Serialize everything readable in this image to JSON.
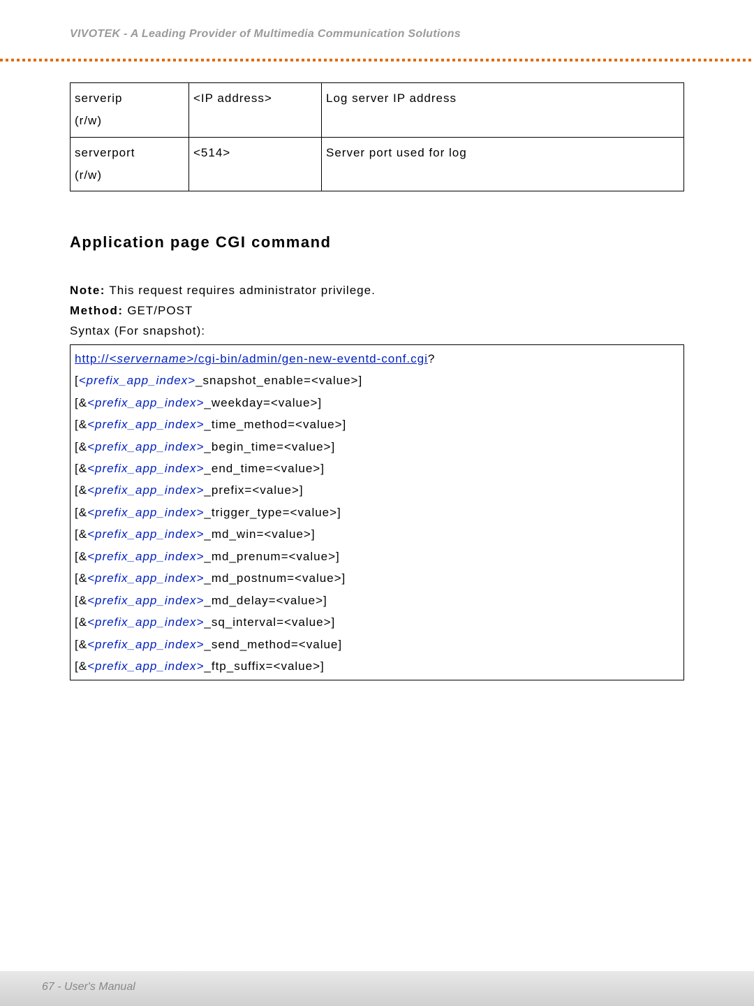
{
  "header": {
    "title": "VIVOTEK - A Leading Provider of Multimedia Communication Solutions"
  },
  "param_table": {
    "rows": [
      {
        "name": "serverip",
        "rw": "(r/w)",
        "value": "<IP address>",
        "desc": "Log server IP address"
      },
      {
        "name": "serverport",
        "rw": "(r/w)",
        "value": "<514>",
        "desc": "Server port used for log"
      }
    ]
  },
  "section": {
    "heading": "Application page CGI command",
    "note_label": "Note:",
    "note_text": " This request requires administrator privilege.",
    "method_label": "Method:",
    "method_text": " GET/POST",
    "syntax_label": "Syntax (For snapshot):"
  },
  "syntax": {
    "url_prefix": "http://",
    "url_server": "<servername>",
    "url_path": "/cgi-bin/admin/gen-new-eventd-conf.cgi",
    "url_q": "?",
    "lines": [
      {
        "open": "[",
        "var": "<prefix_app_index>",
        "after": "_snapshot_enable=<value>]"
      },
      {
        "open": "[&",
        "var": "<prefix_app_index>",
        "after": "_weekday=<value>]"
      },
      {
        "open": "[&",
        "var": "<prefix_app_index>",
        "after": "_time_method=<value>]"
      },
      {
        "open": "[&",
        "var": "<prefix_app_index>",
        "after": "_begin_time=<value>]"
      },
      {
        "open": "[&",
        "var": "<prefix_app_index>",
        "after": "_end_time=<value>]"
      },
      {
        "open": "[&",
        "var": "<prefix_app_index>",
        "after": "_prefix=<value>]"
      },
      {
        "open": "[&",
        "var": "<prefix_app_index>",
        "after": "_trigger_type=<value>]"
      },
      {
        "open": "[&",
        "var": "<prefix_app_index>",
        "after": "_md_win=<value>]"
      },
      {
        "open": "[&",
        "var": "<prefix_app_index>",
        "after": "_md_prenum=<value>]"
      },
      {
        "open": "[&",
        "var": "<prefix_app_index>",
        "after": "_md_postnum=<value>]"
      },
      {
        "open": "[&",
        "var": "<prefix_app_index>",
        "after": "_md_delay=<value>]"
      },
      {
        "open": "[&",
        "var": "<prefix_app_index>",
        "after": "_sq_interval=<value>]"
      },
      {
        "open": "[&",
        "var": "<prefix_app_index>",
        "after": "_send_method=<value]"
      },
      {
        "open": "[&",
        "var": "<prefix_app_index>",
        "after": "_ftp_suffix=<value>]"
      }
    ]
  },
  "footer": {
    "text": "67 - User's Manual"
  }
}
